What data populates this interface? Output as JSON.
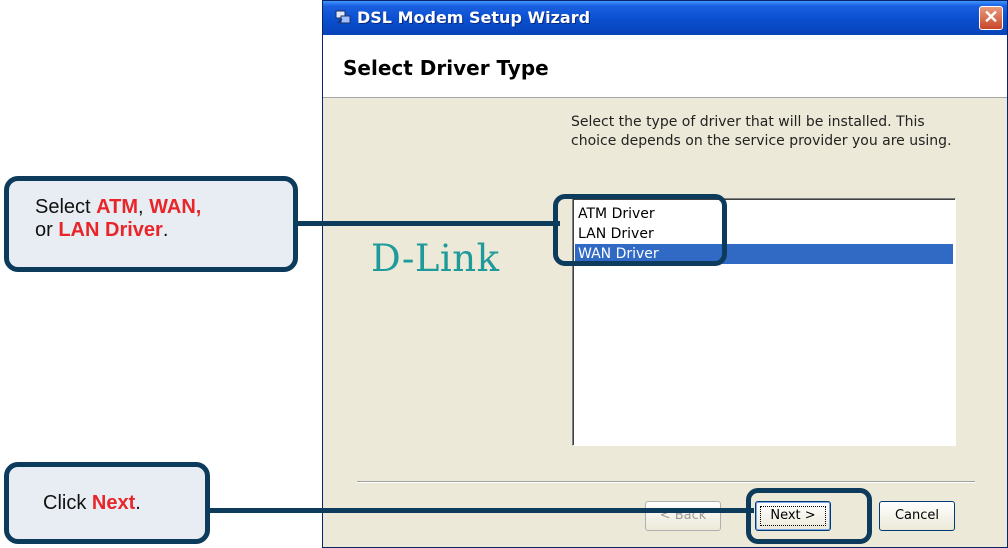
{
  "window": {
    "title": "DSL Modem Setup Wizard",
    "close_glyph": "✕",
    "header_title": "Select Driver Type",
    "logo": "D-Link",
    "description": "Select the type of driver that will be installed. This choice depends on the service provider you are using.",
    "driver_list": {
      "items": [
        "ATM Driver",
        "LAN Driver",
        "WAN Driver"
      ],
      "selected": "WAN Driver"
    },
    "buttons": {
      "back": "< Back",
      "next": "Next >",
      "cancel": "Cancel"
    }
  },
  "callouts": {
    "driver": {
      "prefix": "Select ",
      "atm": "ATM",
      "comma1": ", ",
      "wan": "WAN,",
      "or": "or ",
      "lan": "LAN Driver",
      "period": "."
    },
    "next": {
      "prefix": "Click ",
      "next": "Next",
      "period": "."
    }
  },
  "colors": {
    "accent_red": "#e8262a",
    "callout_border": "#0c3b5b",
    "selection": "#316ac5",
    "logo_teal": "#1e9a9a"
  }
}
